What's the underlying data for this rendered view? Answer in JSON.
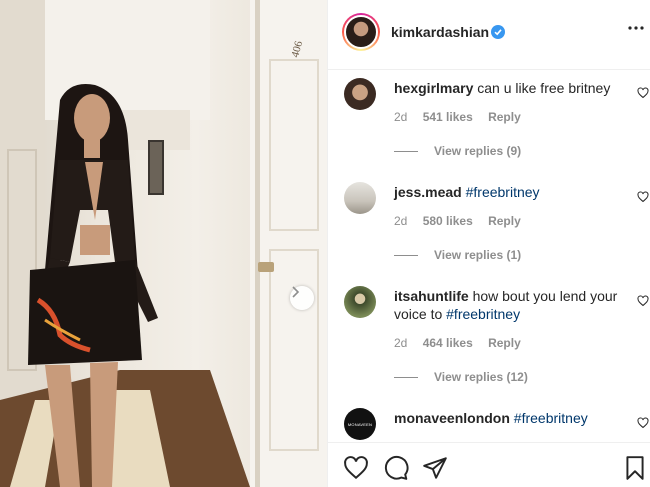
{
  "post": {
    "username": "kimkardashian",
    "verified": true,
    "door_number": "406"
  },
  "comments": [
    {
      "username": "hexgirlmary",
      "text": "can u like free britney",
      "hashtag": "",
      "time": "2d",
      "likes": "541 likes",
      "reply_label": "Reply",
      "view_replies": "View replies (9)"
    },
    {
      "username": "jess.mead",
      "text": "",
      "hashtag": "#freebritney",
      "time": "2d",
      "likes": "580 likes",
      "reply_label": "Reply",
      "view_replies": "View replies (1)"
    },
    {
      "username": "itsahuntlife",
      "text": "how bout you lend your voice to",
      "hashtag": "#freebritney",
      "time": "2d",
      "likes": "464 likes",
      "reply_label": "Reply",
      "view_replies": "View replies (12)"
    },
    {
      "username": "monaveenlondon",
      "text": "",
      "hashtag": "#freebritney",
      "avatar_label": "MONAVEEN"
    }
  ],
  "actions": {
    "like_icon": "heart-icon",
    "comment_icon": "comment-icon",
    "share_icon": "paper-plane-icon",
    "save_icon": "bookmark-icon"
  },
  "colors": {
    "text": "#262626",
    "secondary": "#8e8e8e",
    "hashtag": "#00376b",
    "verified": "#3897f0",
    "border": "#efefef"
  }
}
